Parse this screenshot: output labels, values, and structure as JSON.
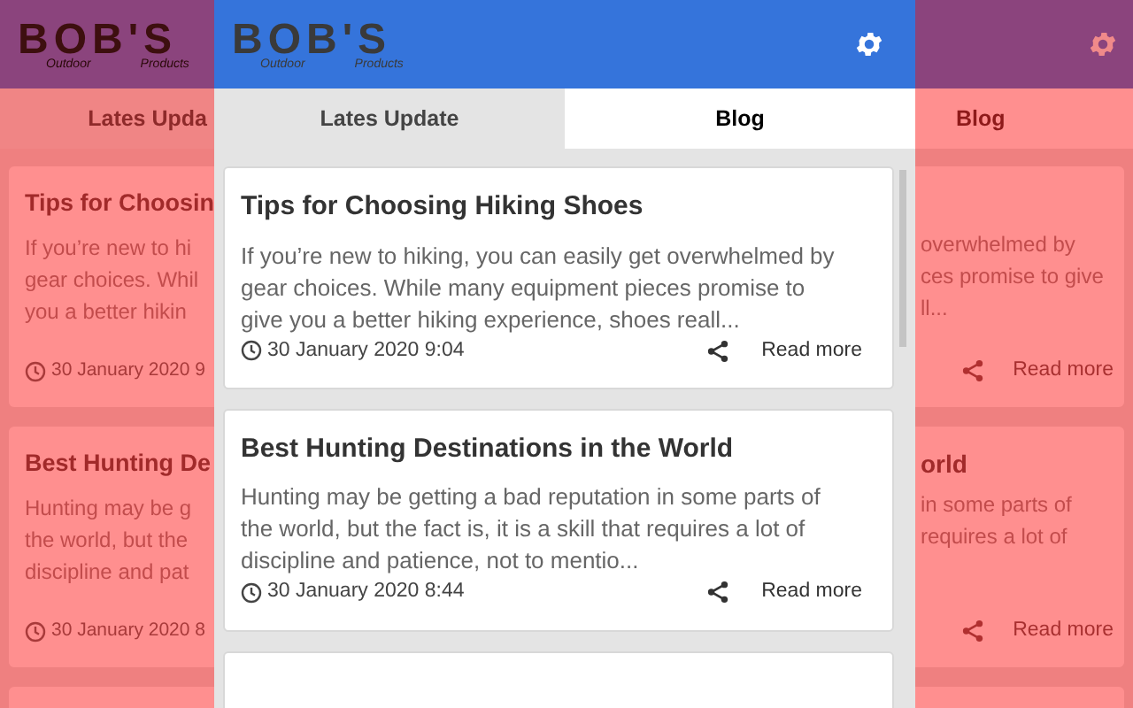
{
  "app": {
    "logo": {
      "wordmark": "BOB'S",
      "tagline_left": "Outdoor",
      "tagline_right": "Products"
    },
    "tabs": [
      {
        "label": "Lates Update",
        "selected": false
      },
      {
        "label": "Blog",
        "selected": true
      }
    ],
    "posts": [
      {
        "title": "Tips for Choosing Hiking Shoes",
        "excerpt": "If you’re new to hiking, you can easily get overwhelmed by gear choices. While many equipment pieces promise to give you a better hiking experience, shoes reall...",
        "date": "30 January 2020 9:04",
        "action": "Read more"
      },
      {
        "title": "Best Hunting Destinations in the World",
        "excerpt": "Hunting may be getting a bad reputation in some parts of the world, but the fact is, it is a skill that requires a lot of discipline and patience, not to mentio...",
        "date": "30 January 2020 8:44",
        "action": "Read more"
      }
    ]
  },
  "backdrop_left": {
    "logo": {
      "wordmark": "BOB'S",
      "tagline_left": "Outdoor",
      "tagline_right": "Products"
    },
    "tab": "Lates Upda",
    "posts": [
      {
        "title": "Tips for Choosin",
        "excerpt_lines": [
          "If you’re new to hi",
          "gear choices. Whil",
          "you a better hikin"
        ],
        "date": "30 January 2020 9"
      },
      {
        "title": "Best Hunting De",
        "excerpt_lines": [
          "Hunting may be g",
          "the world, but the",
          "discipline and pat"
        ],
        "date": "30 January 2020 8"
      }
    ]
  },
  "backdrop_right": {
    "tab": "Blog",
    "posts": [
      {
        "excerpt_lines": [
          "overwhelmed by",
          "ces promise to give",
          "ll..."
        ],
        "action": "Read more"
      },
      {
        "title": "orld",
        "excerpt_lines": [
          "in some parts of",
          "requires a lot of"
        ],
        "action": "Read more"
      }
    ]
  }
}
